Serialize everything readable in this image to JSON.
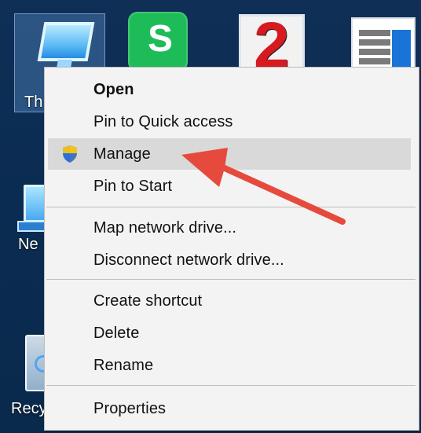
{
  "desktop": {
    "this_pc_label": "Th",
    "network_label": "Ne",
    "recycle_label": "Recy",
    "green_app_icon": "green-s-app-icon",
    "red_app_icon": "red-2-app-icon",
    "doc_app_icon": "document-app-icon"
  },
  "context_menu": {
    "items": [
      {
        "label": "Open"
      },
      {
        "label": "Pin to Quick access"
      },
      {
        "label": "Manage",
        "icon": "shield-icon"
      },
      {
        "label": "Pin to Start"
      },
      {
        "label": "Map network drive..."
      },
      {
        "label": "Disconnect network drive..."
      },
      {
        "label": "Create shortcut"
      },
      {
        "label": "Delete"
      },
      {
        "label": "Rename"
      },
      {
        "label": "Properties"
      }
    ]
  },
  "colors": {
    "desktop": "#0d2d53",
    "menu_bg": "#f3f3f3",
    "highlight": "#d9d9d9",
    "arrow": "#e64a3c"
  }
}
